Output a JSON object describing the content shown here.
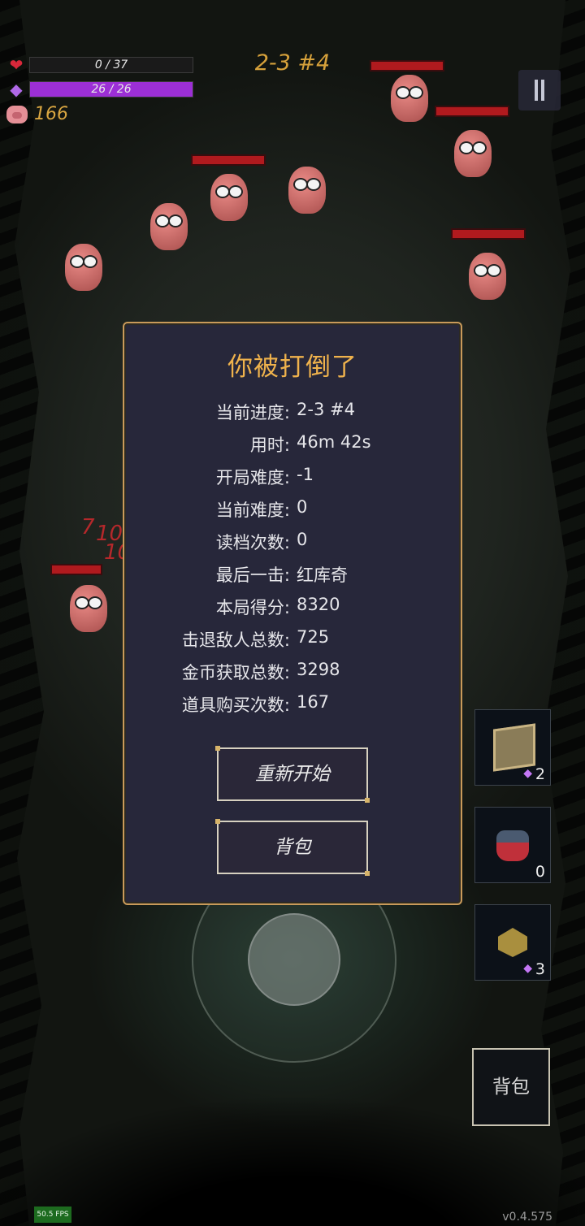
{
  "hud": {
    "hp": {
      "text": "0 / 37",
      "current": 0,
      "max": 37
    },
    "mp": {
      "text": "26 / 26",
      "current": 26,
      "max": 26
    },
    "gold": "166",
    "level": "2-3 #4"
  },
  "colors": {
    "hp": "#d8283a",
    "mp": "#9c2fd6",
    "gold": "#d9a641",
    "dialog_title": "#efb24c",
    "dialog_border": "#c99a5a"
  },
  "damage_numbers": [
    "7",
    "10",
    "7",
    "10",
    "10"
  ],
  "dialog": {
    "title": "你被打倒了",
    "stats": [
      {
        "label": "当前进度:",
        "value": "2-3 #4"
      },
      {
        "label": "用时:",
        "value": "46m 42s"
      },
      {
        "label": "开局难度:",
        "value": "-1"
      },
      {
        "label": "当前难度:",
        "value": "0"
      },
      {
        "label": "读档次数:",
        "value": "0"
      },
      {
        "label": "最后一击:",
        "value": "红库奇"
      },
      {
        "label": "本局得分:",
        "value": "8320"
      },
      {
        "label": "击退敌人总数:",
        "value": "725"
      },
      {
        "label": "金币获取总数:",
        "value": "3298"
      },
      {
        "label": "道具购买次数:",
        "value": "167"
      }
    ],
    "restart_label": "重新开始",
    "bag_label": "背包"
  },
  "items": [
    {
      "icon": "rune-cube-icon",
      "count": "2",
      "cost_gem": "◆"
    },
    {
      "icon": "potion-bottle-icon",
      "count": "0"
    },
    {
      "icon": "dice-icon",
      "count": "3",
      "cost_gem": "◆"
    }
  ],
  "bag_button": "背包",
  "fps": "50.5 FPS",
  "version": "v0.4.575"
}
